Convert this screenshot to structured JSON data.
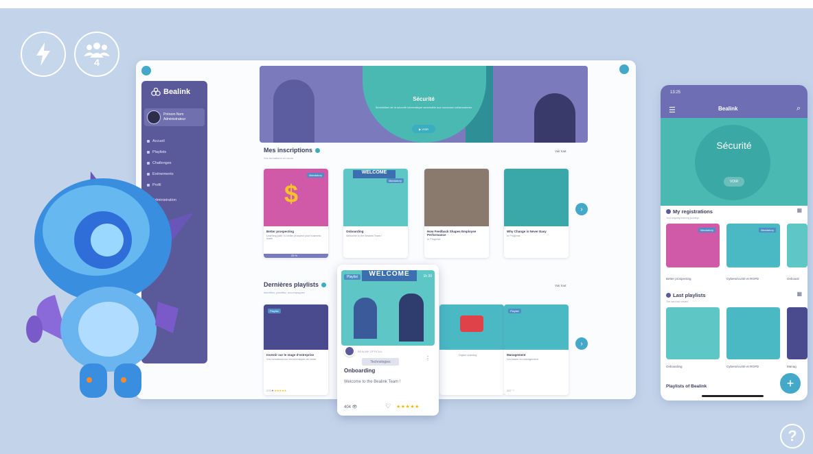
{
  "overlay": {
    "lightning_icon": "lightning-icon",
    "group_icon": "group-icon",
    "participants_count": "4",
    "help_label": "?"
  },
  "desktop": {
    "sidebar": {
      "logo": "Bealink",
      "user_name": "Prénom Nom",
      "user_role": "Administrateur",
      "items": [
        "Accueil",
        "Playlists",
        "Challenges",
        "Evénements",
        "Profil",
        "Administration"
      ]
    },
    "banner": {
      "title": "Sécurité",
      "subtitle": "Sensibiliser de la sécurité informatique accessible aux nouveaux collaborateurs",
      "button": "▶ VOIR"
    },
    "registrations": {
      "title": "Mes inscriptions",
      "subtitle": "Vos formations en cours",
      "more": "Voir tout",
      "cards": [
        {
          "title": "Better prospecting",
          "desc": "Learning path: to better prospect your business leads",
          "tag": "Mandatory",
          "foot": "25 %"
        },
        {
          "title": "Onboarding",
          "desc": "Welcome to the Bealink Team !",
          "tag": "Mandatory",
          "foot": ""
        },
        {
          "title": "How Feedback Shapes Employee Performance",
          "desc": "In Progress",
          "tag": "",
          "foot": ""
        },
        {
          "title": "Why Change is Never Easy",
          "desc": "In Progress",
          "tag": "",
          "foot": ""
        }
      ]
    },
    "playlists": {
      "title": "Dernières playlists",
      "subtitle": "Identifiez, planifiez, accompagnez",
      "more": "Voir tout",
      "cards": [
        {
          "title": "Investir sur le stage d'entreprise",
          "desc": "Vos formations sur les techniques de vente",
          "tag": "Playlist",
          "views": "270",
          "stars": "★★★★★"
        },
        {
          "title": "Digital Learning",
          "desc": "Playlist",
          "tag": "Playlist",
          "views": "",
          "stars": ""
        },
        {
          "title": "Management",
          "desc": "Les bases du management",
          "tag": "Playlist",
          "views": "227",
          "stars": ""
        }
      ]
    }
  },
  "popup": {
    "tag": "Playlist",
    "duration": "1h 30",
    "welcome": "WELCOME",
    "org": "BEALINK OFFICIAL",
    "category": "Technologies",
    "title": "Onboarding",
    "desc": "Welcome to the Bealink Team !",
    "views": "404",
    "stars": "★★★★★"
  },
  "phone": {
    "time": "13:25",
    "logo": "Bealink",
    "hero_title": "Sécurité",
    "hero_button": "VOIR",
    "sec1": "My registrations",
    "sec1_sub": "Your ongoing learning journeys",
    "sec1_cards": [
      {
        "label": "Better prospecting",
        "tag": "Mandatory"
      },
      {
        "label": "Cybersécurité et RGPD",
        "tag": "Mandatory"
      },
      {
        "label": "Onboard",
        "tag": ""
      }
    ],
    "sec2": "Last playlists",
    "sec2_sub": "The last links viewed",
    "sec2_cards": [
      {
        "label": "Onboarding"
      },
      {
        "label": "Cybersécurité et RGPD"
      },
      {
        "label": "Manag"
      }
    ],
    "bottom_title": "Playlists of Bealink",
    "fab": "+"
  },
  "colors": {
    "background": "#c3d4ea",
    "sidebar": "#5a5a9a",
    "accent": "#44a8c8",
    "banner": "#7a7abc"
  }
}
